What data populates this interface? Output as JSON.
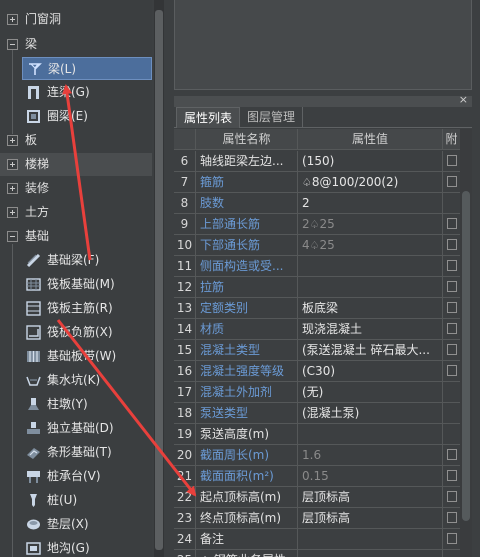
{
  "tree": {
    "groups": [
      {
        "label": "门窗洞",
        "expanded": false
      },
      {
        "label": "梁",
        "expanded": true
      },
      {
        "label": "板",
        "expanded": false
      },
      {
        "label": "楼梯",
        "expanded": false
      },
      {
        "label": "装修",
        "expanded": false
      },
      {
        "label": "土方",
        "expanded": false
      },
      {
        "label": "基础",
        "expanded": true
      }
    ],
    "beam_items": [
      {
        "label": "梁(L)",
        "icon": "beam-icon",
        "selected": true
      },
      {
        "label": "连梁(G)",
        "icon": "coupling-beam-icon",
        "selected": false
      },
      {
        "label": "圈梁(E)",
        "icon": "ring-beam-icon",
        "selected": false
      }
    ],
    "foundation_items": [
      {
        "label": "基础梁(F)",
        "icon": "foundation-beam-icon"
      },
      {
        "label": "筏板基础(M)",
        "icon": "raft-foundation-icon"
      },
      {
        "label": "筏板主筋(R)",
        "icon": "raft-main-rebar-icon"
      },
      {
        "label": "筏板负筋(X)",
        "icon": "raft-negative-rebar-icon"
      },
      {
        "label": "基础板带(W)",
        "icon": "foundation-strip-icon"
      },
      {
        "label": "集水坑(K)",
        "icon": "sump-icon"
      },
      {
        "label": "柱墩(Y)",
        "icon": "column-pier-icon"
      },
      {
        "label": "独立基础(D)",
        "icon": "isolated-footing-icon"
      },
      {
        "label": "条形基础(T)",
        "icon": "strip-footing-icon"
      },
      {
        "label": "桩承台(V)",
        "icon": "pile-cap-icon"
      },
      {
        "label": "桩(U)",
        "icon": "pile-icon"
      },
      {
        "label": "垫层(X)",
        "icon": "cushion-icon"
      },
      {
        "label": "地沟(G)",
        "icon": "trench-icon"
      }
    ]
  },
  "props": {
    "close_glyph": "×",
    "tabs": {
      "active": "属性列表",
      "inactive": "图层管理"
    },
    "header": {
      "name": "属性名称",
      "value": "属性值",
      "add": "附"
    },
    "rows": [
      {
        "n": "6",
        "name": "轴线距梁左边...",
        "value": "(150)",
        "blue": false,
        "gray": false,
        "cb": true
      },
      {
        "n": "7",
        "name": "箍筋",
        "value": "8@100/200(2)",
        "rebar": true,
        "blue": true,
        "gray": false,
        "cb": true
      },
      {
        "n": "8",
        "name": "肢数",
        "value": "2",
        "blue": true,
        "gray": false,
        "cb": false
      },
      {
        "n": "9",
        "name": "上部通长筋",
        "value_pre": "2",
        "value": "25",
        "rebar": true,
        "blue": true,
        "gray": true,
        "cb": true
      },
      {
        "n": "10",
        "name": "下部通长筋",
        "value_pre": "4",
        "value": "25",
        "rebar": true,
        "blue": true,
        "gray": true,
        "cb": true
      },
      {
        "n": "11",
        "name": "侧面构造或受...",
        "value": "",
        "blue": true,
        "gray": false,
        "cb": true
      },
      {
        "n": "12",
        "name": "拉筋",
        "value": "",
        "blue": true,
        "gray": false,
        "cb": true
      },
      {
        "n": "13",
        "name": "定额类别",
        "value": "板底梁",
        "blue": true,
        "gray": false,
        "cb": true
      },
      {
        "n": "14",
        "name": "材质",
        "value": "现浇混凝土",
        "blue": true,
        "gray": false,
        "cb": true
      },
      {
        "n": "15",
        "name": "混凝土类型",
        "value": "(泵送混凝土 碎石最大...",
        "blue": true,
        "gray": false,
        "cb": true
      },
      {
        "n": "16",
        "name": "混凝土强度等级",
        "value": "(C30)",
        "blue": true,
        "gray": false,
        "cb": true
      },
      {
        "n": "17",
        "name": "混凝土外加剂",
        "value": "(无)",
        "blue": true,
        "gray": false,
        "cb": false
      },
      {
        "n": "18",
        "name": "泵送类型",
        "value": "(混凝土泵)",
        "blue": true,
        "gray": false,
        "cb": false
      },
      {
        "n": "19",
        "name": "泵送高度(m)",
        "value": "",
        "blue": false,
        "gray": false,
        "cb": false
      },
      {
        "n": "20",
        "name": "截面周长(m)",
        "value": "1.6",
        "blue": true,
        "gray": true,
        "cb": true
      },
      {
        "n": "21",
        "name": "截面面积(m²)",
        "value": "0.15",
        "blue": true,
        "gray": true,
        "cb": true
      },
      {
        "n": "22",
        "name": "起点顶标高(m)",
        "value": "层顶标高",
        "blue": false,
        "gray": false,
        "cb": true
      },
      {
        "n": "23",
        "name": "终点顶标高(m)",
        "value": "层顶标高",
        "blue": false,
        "gray": false,
        "cb": true
      },
      {
        "n": "24",
        "name": "备注",
        "value": "",
        "blue": false,
        "gray": false,
        "cb": true
      },
      {
        "n": "25",
        "name": "+ 钢筋业务属性",
        "value": "",
        "blue": false,
        "gray": false,
        "cb": false
      }
    ]
  },
  "colors": {
    "accent_arrow": "#e8403c",
    "selection": "#4c6e9c",
    "blue_text": "#6b9bd6"
  }
}
